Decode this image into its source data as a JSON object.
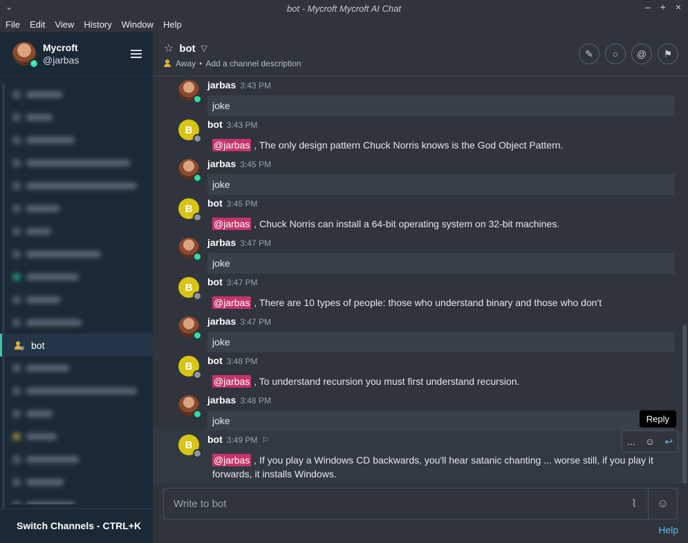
{
  "window": {
    "title": "bot - Mycroft Mycroft AI Chat"
  },
  "menu": [
    "File",
    "Edit",
    "View",
    "History",
    "Window",
    "Help"
  ],
  "sidebar": {
    "user_name": "Mycroft",
    "user_handle": "@jarbas",
    "active_channel": "bot",
    "switch_label": "Switch Channels - CTRL+K"
  },
  "room": {
    "name": "bot",
    "status": "Away",
    "description_placeholder": "Add a channel description"
  },
  "messages": [
    {
      "user": "jarbas",
      "time": "3:43 PM",
      "text": "joke"
    },
    {
      "user": "bot",
      "time": "3:43 PM",
      "mention": "@jarbas",
      "text": " , The only design pattern Chuck Norris knows is the God Object Pattern."
    },
    {
      "user": "jarbas",
      "time": "3:45 PM",
      "text": "joke"
    },
    {
      "user": "bot",
      "time": "3:45 PM",
      "mention": "@jarbas",
      "text": " , Chuck Norris can install a 64-bit operating system on 32-bit machines."
    },
    {
      "user": "jarbas",
      "time": "3:47 PM",
      "text": "joke"
    },
    {
      "user": "bot",
      "time": "3:47 PM",
      "mention": "@jarbas",
      "text": " , There are 10 types of people: those who understand binary and those who don't"
    },
    {
      "user": "jarbas",
      "time": "3:47 PM",
      "text": "joke"
    },
    {
      "user": "bot",
      "time": "3:48 PM",
      "mention": "@jarbas",
      "text": " , To understand recursion you must first understand recursion."
    },
    {
      "user": "jarbas",
      "time": "3:48 PM",
      "text": "joke"
    },
    {
      "user": "bot",
      "time": "3:49 PM",
      "mention": "@jarbas",
      "text": " , If you play a Windows CD backwards, you'll hear satanic chanting ... worse still, if you play it forwards, it installs Windows."
    }
  ],
  "hover_toolbar": {
    "more": "...",
    "tooltip": "Reply"
  },
  "bot_avatar_letter": "B",
  "composer": {
    "placeholder": "Write to bot"
  },
  "help_link": "Help",
  "colors": {
    "accent": "#3ec7a9",
    "mention": "#c5346a",
    "link": "#5fbbe8",
    "bot_avatar": "#d8c513"
  }
}
